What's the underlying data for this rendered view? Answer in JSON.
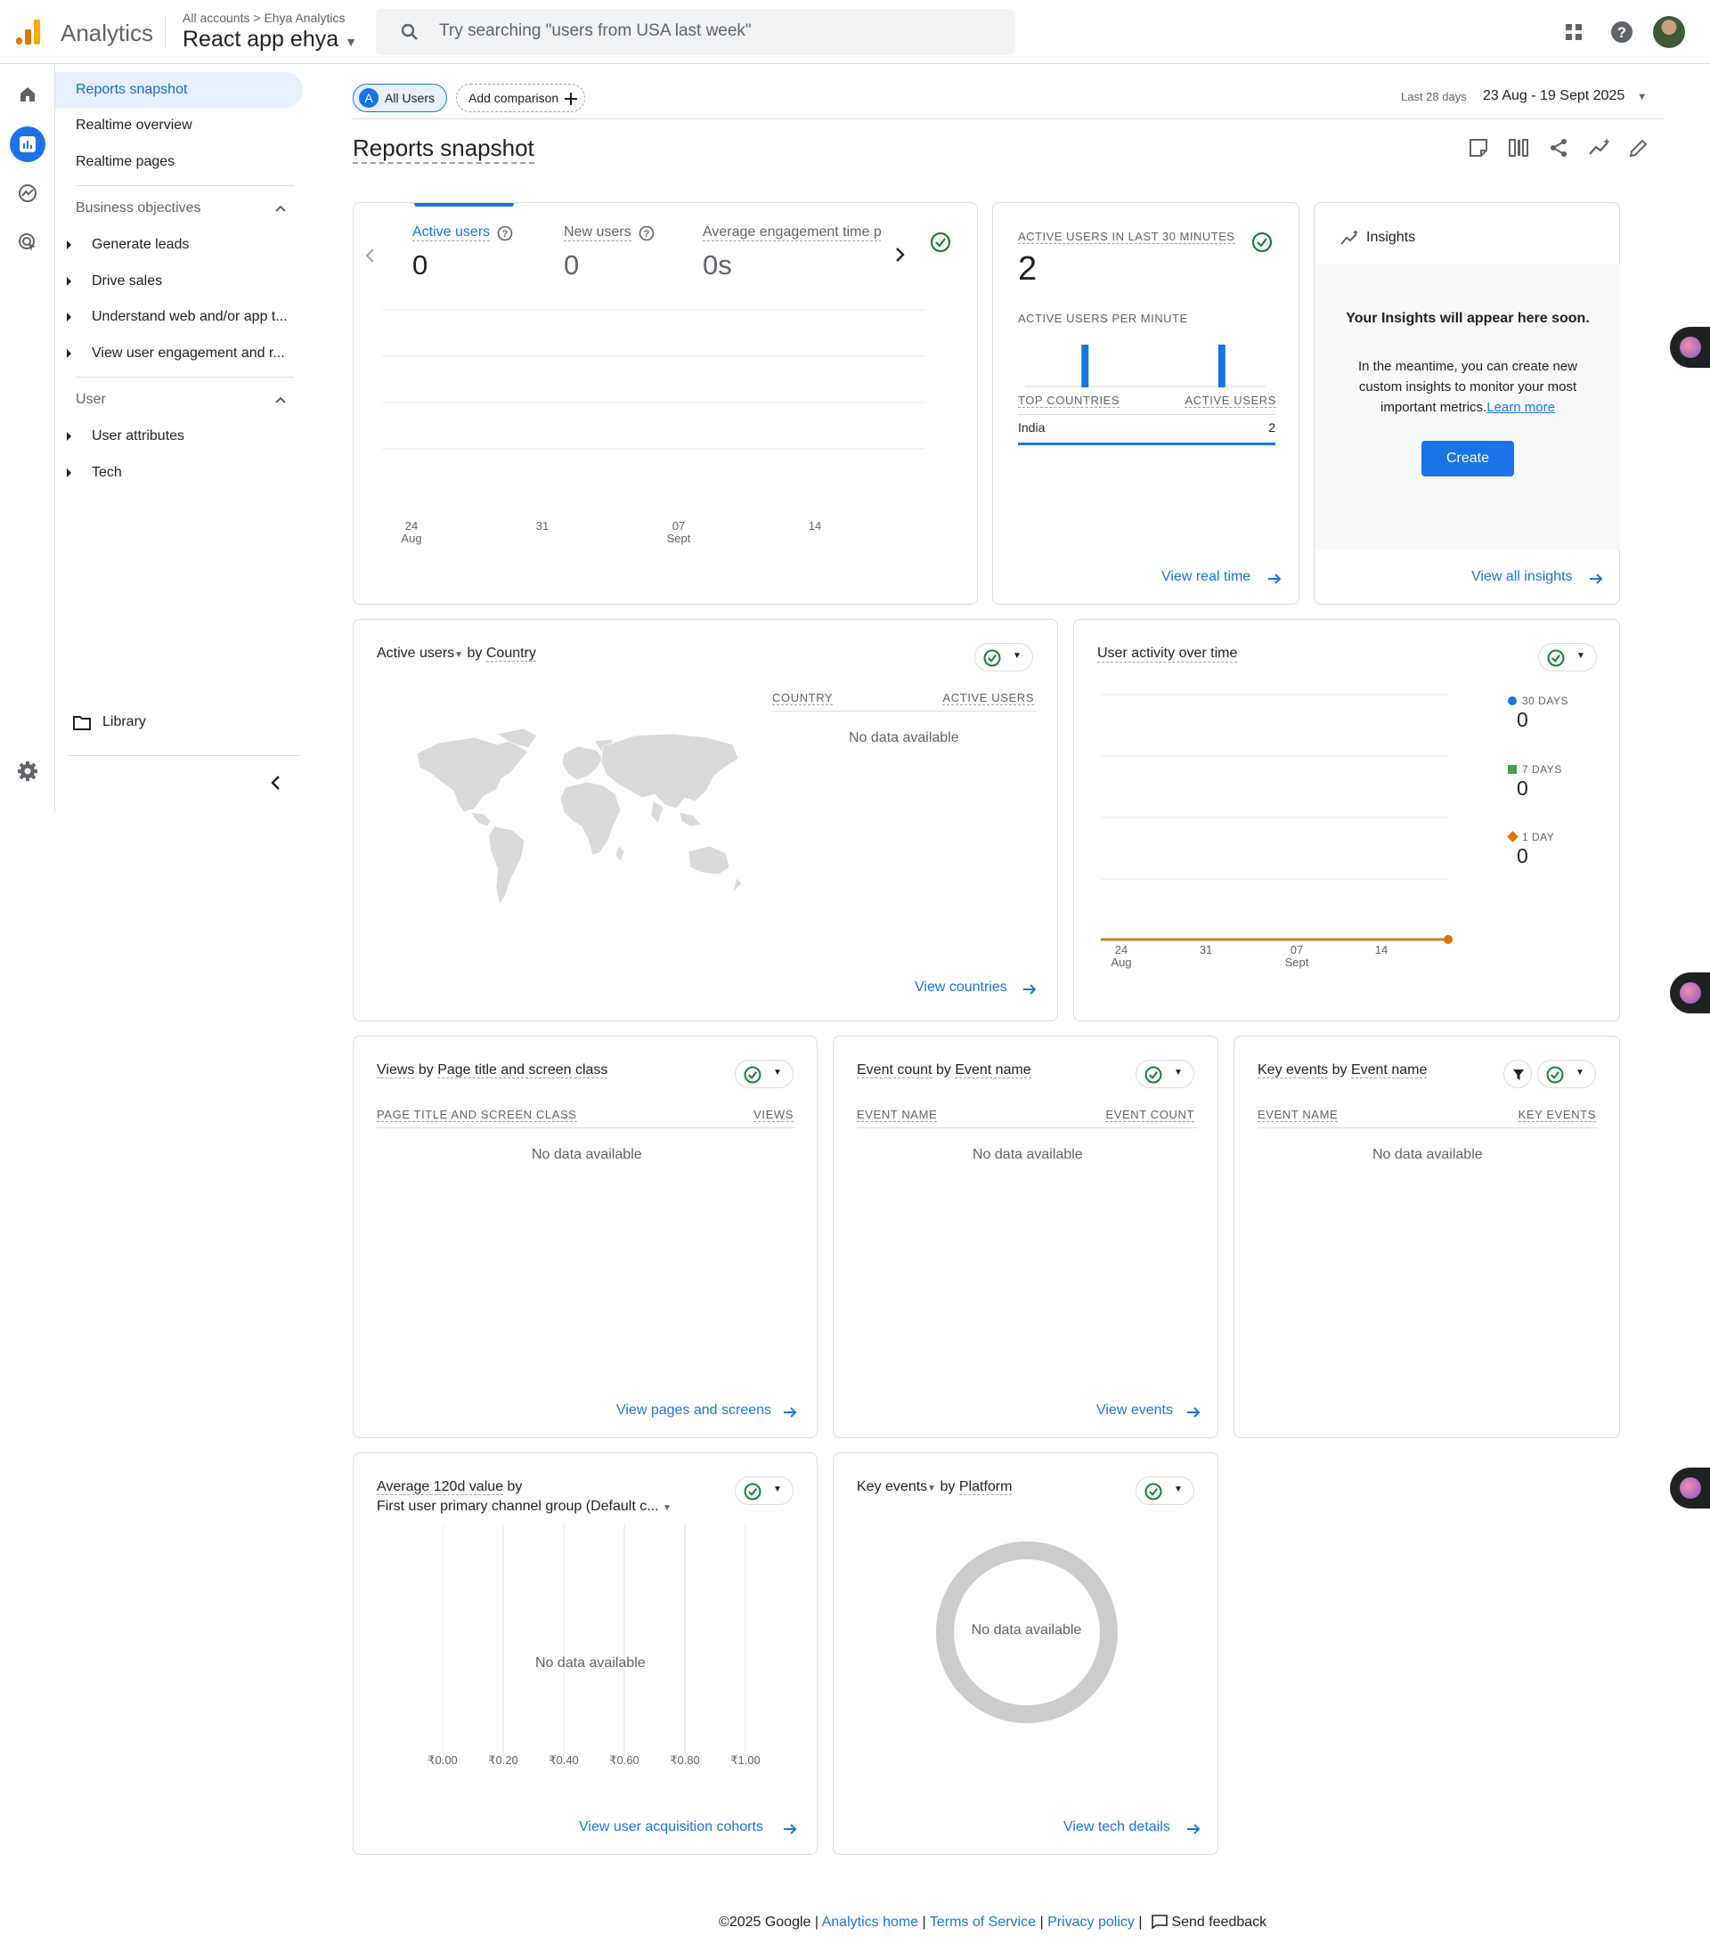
{
  "header": {
    "app_name": "Analytics",
    "account_path": "All accounts > Ehya Analytics",
    "property_name": "React app ehya",
    "search_placeholder": "Try searching \"users from USA last week\""
  },
  "nav": {
    "items": [
      "Reports snapshot",
      "Realtime overview",
      "Realtime pages"
    ],
    "business_objectives": {
      "title": "Business objectives",
      "items": [
        "Generate leads",
        "Drive sales",
        "Understand web and/or app t...",
        "View user engagement and r..."
      ]
    },
    "user": {
      "title": "User",
      "items": [
        "User attributes",
        "Tech"
      ]
    },
    "library": "Library"
  },
  "toolbar": {
    "all_users_letter": "A",
    "all_users": "All Users",
    "add_comparison": "Add comparison",
    "date_label": "Last 28 days",
    "date_range": "23 Aug - 19 Sept 2025",
    "page_title": "Reports snapshot"
  },
  "summary_card": {
    "metrics": [
      {
        "label": "Active users",
        "value": "0"
      },
      {
        "label": "New users",
        "value": "0"
      },
      {
        "label": "Average engagement time p",
        "value": "0s"
      }
    ],
    "x_ticks": [
      {
        "day": "24",
        "month": "Aug"
      },
      {
        "day": "31",
        "month": ""
      },
      {
        "day": "07",
        "month": "Sept"
      },
      {
        "day": "14",
        "month": ""
      }
    ]
  },
  "realtime_card": {
    "title": "ACTIVE USERS IN LAST 30 MINUTES",
    "value": "2",
    "per_minute_label": "ACTIVE USERS PER MINUTE",
    "col1": "TOP COUNTRIES",
    "col2": "ACTIVE USERS",
    "rows": [
      {
        "country": "India",
        "users": "2"
      }
    ],
    "link": "View real time"
  },
  "insights_card": {
    "title": "Insights",
    "headline": "Your Insights will appear here soon.",
    "body1": "In the meantime, you can create new",
    "body2": "custom insights to monitor your most",
    "body3": "important metrics.",
    "learn_more": "Learn more",
    "create": "Create",
    "link": "View all insights"
  },
  "country_card": {
    "metric": "Active users",
    "by": "by",
    "dimension": "Country",
    "col1": "COUNTRY",
    "col2": "ACTIVE USERS",
    "nodata": "No data available",
    "link": "View countries"
  },
  "activity_card": {
    "title": "User activity over time",
    "legend": [
      {
        "label": "30 DAYS",
        "value": "0",
        "color": "#1a73e8"
      },
      {
        "label": "7 DAYS",
        "value": "0",
        "color": "#43a047"
      },
      {
        "label": "1 DAY",
        "value": "0",
        "color": "#e37400"
      }
    ],
    "x_ticks": [
      {
        "day": "24",
        "month": "Aug"
      },
      {
        "day": "31",
        "month": ""
      },
      {
        "day": "07",
        "month": "Sept"
      },
      {
        "day": "14",
        "month": ""
      }
    ]
  },
  "views_card": {
    "title_a": "Views",
    "by": "by",
    "title_b": "Page title and screen class",
    "col1": "PAGE TITLE AND SCREEN CLASS",
    "col2": "VIEWS",
    "nodata": "No data available",
    "link": "View pages and screens"
  },
  "events_card": {
    "title_a": "Event count",
    "by": "by",
    "title_b": "Event name",
    "col1": "EVENT NAME",
    "col2": "EVENT COUNT",
    "nodata": "No data available",
    "link": "View events"
  },
  "keyevents_card": {
    "title_a": "Key events",
    "by": "by",
    "title_b": "Event name",
    "col1": "EVENT NAME",
    "col2": "KEY EVENTS",
    "nodata": "No data available"
  },
  "value_card": {
    "title_a": "Average 120d value",
    "by": "by",
    "title_b": "First user primary channel group (Default c...",
    "nodata": "No data available",
    "ticks": [
      "₹0.00",
      "₹0.20",
      "₹0.40",
      "₹0.60",
      "₹0.80",
      "₹1.00"
    ],
    "link": "View user acquisition cohorts"
  },
  "platform_card": {
    "title_a": "Key events",
    "by": "by",
    "title_b": "Platform",
    "nodata": "No data available",
    "link": "View tech details"
  },
  "footer": {
    "copyright": "©2025 Google |",
    "home": "Analytics home",
    "sep1": "|",
    "tos": "Terms of Service",
    "sep2": "|",
    "privacy": "Privacy policy",
    "sep3": "|",
    "feedback": "Send feedback"
  },
  "chart_data": [
    {
      "type": "line",
      "x": [
        "24 Aug",
        "31",
        "07 Sept",
        "14"
      ],
      "series": [
        {
          "name": "Active users",
          "values": [
            0,
            0,
            0,
            0
          ]
        }
      ]
    },
    {
      "type": "bar",
      "title": "ACTIVE USERS PER MINUTE",
      "values": [
        0,
        0,
        0,
        0,
        0,
        0,
        0,
        0,
        0,
        0,
        0,
        0,
        0,
        0,
        0,
        0,
        0,
        0,
        0,
        0,
        0,
        0,
        0,
        0,
        0,
        0,
        0,
        0,
        0,
        0
      ],
      "markers": [
        {
          "index": 7,
          "value": 1
        },
        {
          "index": 24,
          "value": 1
        }
      ]
    },
    {
      "type": "line",
      "title": "User activity over time",
      "x": [
        "24 Aug",
        "31",
        "07 Sept",
        "14"
      ],
      "series": [
        {
          "name": "30 DAYS",
          "values": [
            0,
            0,
            0,
            0
          ]
        },
        {
          "name": "7 DAYS",
          "values": [
            0,
            0,
            0,
            0
          ]
        },
        {
          "name": "1 DAY",
          "values": [
            0,
            0,
            0,
            0
          ]
        }
      ]
    },
    {
      "type": "bar",
      "title": "Average 120d value by First user primary channel group (Default c...",
      "xlim": [
        0,
        1
      ],
      "ticks": [
        "₹0.00",
        "₹0.20",
        "₹0.40",
        "₹0.60",
        "₹0.80",
        "₹1.00"
      ],
      "values": []
    },
    {
      "type": "pie",
      "title": "Key events by Platform",
      "values": []
    }
  ]
}
